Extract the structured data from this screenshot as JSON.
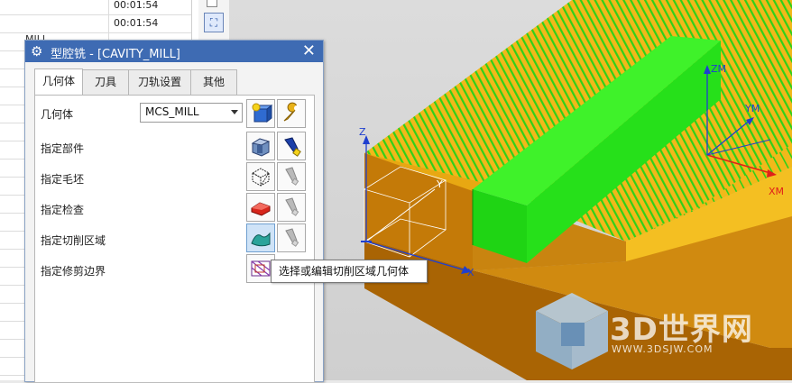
{
  "background_sheet": {
    "times": [
      "00:01:54",
      "00:01:54"
    ],
    "partial_text": "MILL"
  },
  "dialog": {
    "title": "型腔铣 - [CAVITY_MILL]",
    "close_symbol": "✕",
    "tabs": [
      "几何体",
      "刀具",
      "刀轨设置",
      "其他"
    ],
    "active_tab": "几何体",
    "geometry_label": "几何体",
    "geometry_value": "MCS_MILL",
    "rows": [
      "指定部件",
      "指定毛坯",
      "指定检查",
      "指定切削区域",
      "指定修剪边界"
    ]
  },
  "tooltip": "选择或编辑切削区域几何体",
  "axes": {
    "wcs": [
      "Z",
      "Y",
      "X"
    ],
    "mcs": [
      "ZM",
      "YM",
      "XM"
    ]
  },
  "watermark": {
    "main": "3D世界网",
    "url": "WWW.3DSJW.COM"
  },
  "colors": {
    "title_bar": "#3e6bb3",
    "stock_top": "#f2b81a",
    "stock_side": "#c47a08",
    "part_green": "#24e21a",
    "toolpath_green": "#2fd01a",
    "axis_red": "#e0201a",
    "axis_blue": "#1f3fcf"
  }
}
